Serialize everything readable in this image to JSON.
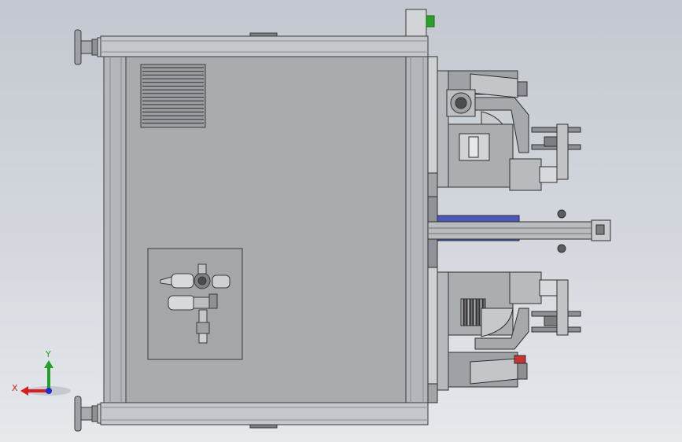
{
  "viewport": {
    "background_top": "#c3c8d0",
    "background_bottom": "#e6e8ec"
  },
  "triad": {
    "x_label": "X",
    "y_label": "Y",
    "x_color": "#d42020",
    "y_color": "#22a02a",
    "z_color": "#1e2fd0"
  },
  "model": {
    "frame_color": "#b9bcc0",
    "panel_color": "#a9acaf",
    "edge_color": "#3a3a3a",
    "accent_green": "#2aa02a",
    "accent_blue": "#4a58b8",
    "accent_red": "#c83232"
  }
}
